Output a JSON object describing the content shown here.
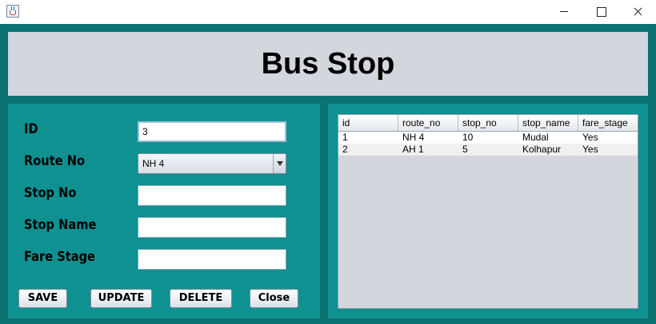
{
  "window": {
    "icon": "java-cup-icon",
    "controls": [
      "minimize-icon",
      "maximize-icon",
      "close-icon"
    ]
  },
  "header": {
    "title": "Bus Stop"
  },
  "form": {
    "id_label": "ID",
    "id_value": "3",
    "route_label": "Route No",
    "route_value": "NH 4",
    "stop_no_label": "Stop No",
    "stop_no_value": "",
    "stop_name_label": "Stop Name",
    "stop_name_value": "",
    "fare_stage_label": "Fare Stage",
    "fare_stage_value": ""
  },
  "buttons": {
    "save": "SAVE",
    "update": "UPDATE",
    "delete": "DELETE",
    "close": "Close"
  },
  "table": {
    "headers": [
      "id",
      "route_no",
      "stop_no",
      "stop_name",
      "fare_stage"
    ],
    "rows": [
      [
        "1",
        "NH 4",
        "10",
        "Mudal",
        "Yes"
      ],
      [
        "2",
        "AH 1",
        "5",
        "Kolhapur",
        "Yes"
      ]
    ]
  },
  "colors": {
    "frame": "#0c7272",
    "panel": "#0f9191",
    "header_bg": "#d4d6de",
    "table_bg": "#d4d6de"
  }
}
